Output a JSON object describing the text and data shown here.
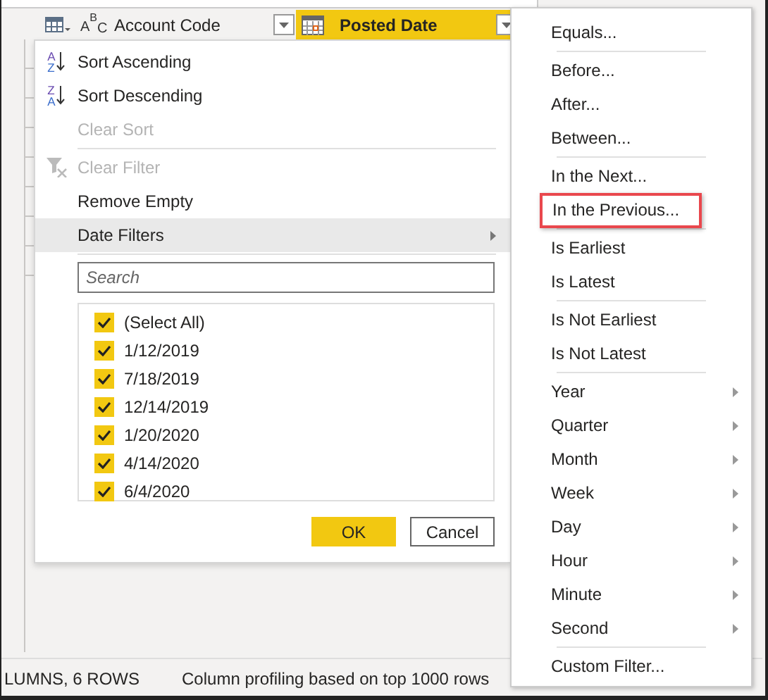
{
  "columns": [
    {
      "type_glyph": "ABC",
      "kind": "text",
      "label": "Account Code",
      "selected": false
    },
    {
      "kind": "date",
      "label": "Posted Date",
      "selected": true
    }
  ],
  "menu": [
    {
      "kind": "sort",
      "glyph": "AZ",
      "label": "Sort Ascending",
      "disabled": false,
      "highlighted": false
    },
    {
      "kind": "sort",
      "glyph": "ZA",
      "label": "Sort Descending",
      "disabled": false,
      "highlighted": false
    },
    {
      "kind": "item",
      "label": "Clear Sort",
      "disabled": true,
      "highlighted": false
    },
    {
      "kind": "separator"
    },
    {
      "kind": "clear-filter",
      "label": "Clear Filter",
      "disabled": true,
      "highlighted": false
    },
    {
      "kind": "item",
      "label": "Remove Empty",
      "disabled": false,
      "highlighted": false
    },
    {
      "kind": "submenu",
      "label": "Date Filters",
      "disabled": false,
      "highlighted": true
    },
    {
      "kind": "separator"
    }
  ],
  "search": {
    "placeholder": "Search"
  },
  "values": [
    {
      "label": "(Select All)",
      "checked": true
    },
    {
      "label": "1/12/2019",
      "checked": true
    },
    {
      "label": "7/18/2019",
      "checked": true
    },
    {
      "label": "12/14/2019",
      "checked": true
    },
    {
      "label": "1/20/2020",
      "checked": true
    },
    {
      "label": "4/14/2020",
      "checked": true
    },
    {
      "label": "6/4/2020",
      "checked": true
    }
  ],
  "buttons": [
    {
      "label": "OK",
      "kind": "primary"
    },
    {
      "label": "Cancel",
      "kind": "secondary"
    }
  ],
  "submenu": [
    {
      "kind": "item",
      "label": "Equals...",
      "outlined": false
    },
    {
      "kind": "separator"
    },
    {
      "kind": "item",
      "label": "Before...",
      "outlined": false
    },
    {
      "kind": "item",
      "label": "After...",
      "outlined": false
    },
    {
      "kind": "item",
      "label": "Between...",
      "outlined": false
    },
    {
      "kind": "separator"
    },
    {
      "kind": "item",
      "label": "In the Next...",
      "outlined": false
    },
    {
      "kind": "item",
      "label": "In the Previous...",
      "outlined": true
    },
    {
      "kind": "separator"
    },
    {
      "kind": "item",
      "label": "Is Earliest",
      "outlined": false
    },
    {
      "kind": "item",
      "label": "Is Latest",
      "outlined": false
    },
    {
      "kind": "separator"
    },
    {
      "kind": "item",
      "label": "Is Not Earliest",
      "outlined": false
    },
    {
      "kind": "item",
      "label": "Is Not Latest",
      "outlined": false
    },
    {
      "kind": "separator"
    },
    {
      "kind": "submenu",
      "label": "Year",
      "outlined": false
    },
    {
      "kind": "submenu",
      "label": "Quarter",
      "outlined": false
    },
    {
      "kind": "submenu",
      "label": "Month",
      "outlined": false
    },
    {
      "kind": "submenu",
      "label": "Week",
      "outlined": false
    },
    {
      "kind": "submenu",
      "label": "Day",
      "outlined": false
    },
    {
      "kind": "submenu",
      "label": "Hour",
      "outlined": false
    },
    {
      "kind": "submenu",
      "label": "Minute",
      "outlined": false
    },
    {
      "kind": "submenu",
      "label": "Second",
      "outlined": false
    },
    {
      "kind": "separator"
    },
    {
      "kind": "item",
      "label": "Custom Filter...",
      "outlined": false
    }
  ],
  "status_bar": {
    "counts": "LUMNS, 6 ROWS",
    "profiling": "Column profiling based on top 1000 rows"
  }
}
